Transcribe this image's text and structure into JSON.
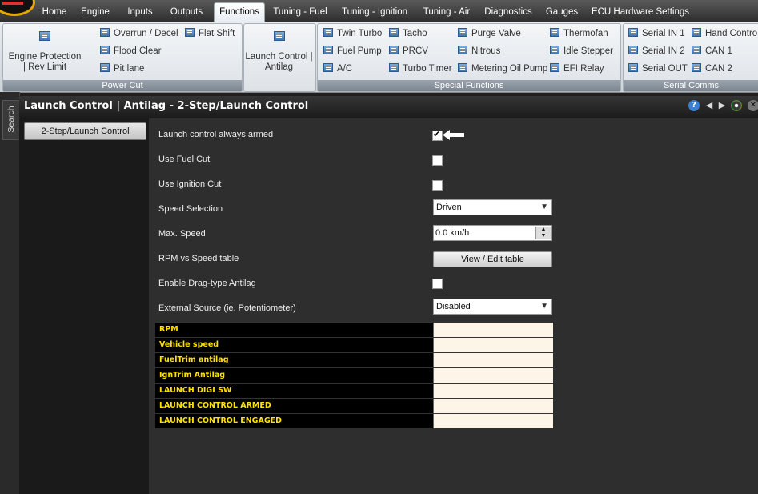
{
  "tabs": [
    {
      "label": "Home",
      "active": false
    },
    {
      "label": "Engine",
      "active": false
    },
    {
      "label": "Inputs",
      "active": false
    },
    {
      "label": "Outputs",
      "active": false
    },
    {
      "label": "Functions",
      "active": true
    },
    {
      "label": "Tuning - Fuel",
      "active": false
    },
    {
      "label": "Tuning - Ignition",
      "active": false
    },
    {
      "label": "Tuning - Air",
      "active": false
    },
    {
      "label": "Diagnostics",
      "active": false
    },
    {
      "label": "Gauges",
      "active": false
    },
    {
      "label": "ECU Hardware Settings",
      "active": false
    }
  ],
  "ribbon": {
    "power_cut": {
      "label": "Power Cut",
      "big": "Engine Protection | Rev Limit",
      "items": [
        "Overrun / Decel",
        "Flat Shift",
        "Flood Clear",
        "Pit lane"
      ]
    },
    "launch": {
      "big": "Launch Control | Antilag"
    },
    "special": {
      "label": "Special Functions",
      "items": [
        "Twin Turbo",
        "Tacho",
        "Purge Valve",
        "Thermofan",
        "Fuel Pump",
        "PRCV",
        "Nitrous",
        "Idle Stepper",
        "A/C",
        "Turbo Timer",
        "Metering Oil Pump",
        "EFI Relay"
      ]
    },
    "serial": {
      "label": "Serial Comms",
      "items": [
        "Serial IN 1",
        "Hand Control",
        "Serial IN 2",
        "CAN 1",
        "Serial OUT",
        "CAN 2"
      ]
    }
  },
  "search_label": "Search",
  "page_title": "Launch Control | Antilag - 2-Step/Launch Control",
  "side_nav": {
    "button": "2-Step/Launch Control"
  },
  "form": {
    "launch_armed": {
      "label": "Launch control always armed",
      "checked": true
    },
    "use_fuel_cut": {
      "label": "Use Fuel Cut",
      "checked": false
    },
    "use_ign_cut": {
      "label": "Use Ignition Cut",
      "checked": false
    },
    "speed_selection": {
      "label": "Speed Selection",
      "value": "Driven"
    },
    "max_speed": {
      "label": "Max. Speed",
      "value": "0.0 km/h"
    },
    "rpm_speed_table": {
      "label": "RPM vs Speed table",
      "button": "View / Edit table"
    },
    "drag_antilag": {
      "label": "Enable Drag-type Antilag",
      "checked": false
    },
    "external_source": {
      "label": "External Source (ie. Potentiometer)",
      "value": "Disabled"
    }
  },
  "table_rows": [
    "RPM",
    "Vehicle speed",
    "FuelTrim antilag",
    "IgnTrim Antilag",
    "LAUNCH DIGI SW",
    "LAUNCH CONTROL ARMED",
    "LAUNCH CONTROL ENGAGED"
  ],
  "colors": {
    "table_label_text": "#ffe200",
    "table_value_bg": "#fdf5e8",
    "accent": "#3f78b8"
  }
}
